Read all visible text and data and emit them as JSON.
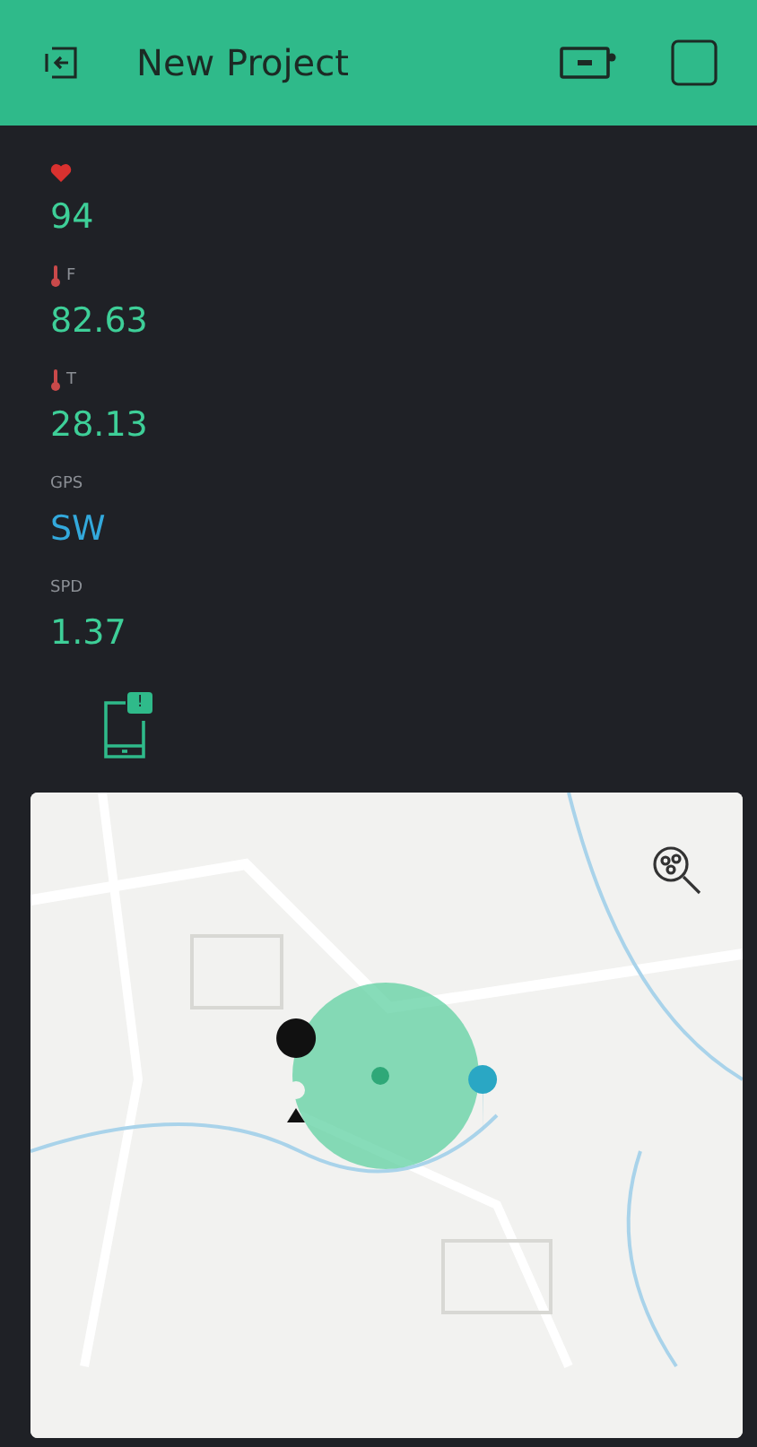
{
  "header": {
    "title": "New Project"
  },
  "widgets": [
    {
      "kind": "heart",
      "value": "94",
      "color": "#3ecf98"
    },
    {
      "kind": "thermometer",
      "label": "F",
      "value": "82.63",
      "color": "#3ecf98"
    },
    {
      "kind": "thermometer",
      "label": "T",
      "value": "28.13",
      "color": "#3ecf98"
    },
    {
      "kind": "text",
      "label": "GPS",
      "value": "SW",
      "color": "#33a9dc"
    },
    {
      "kind": "text",
      "label": "SPD",
      "value": "1.37",
      "color": "#3ecf98"
    }
  ],
  "notification": {
    "badge": "!"
  }
}
